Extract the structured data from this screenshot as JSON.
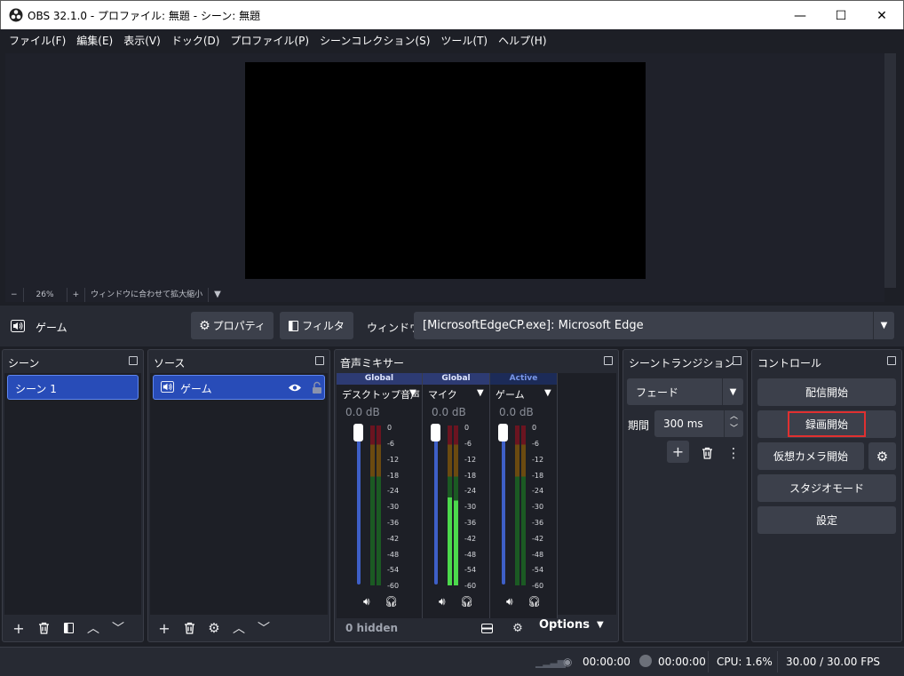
{
  "window": {
    "title": "OBS 32.1.0 - プロファイル: 無題 - シーン: 無題",
    "minimize": "—",
    "maximize": "☐",
    "close": "✕"
  },
  "menu": [
    "ファイル(F)",
    "編集(E)",
    "表示(V)",
    "ドック(D)",
    "プロファイル(P)",
    "シーンコレクション(S)",
    "ツール(T)",
    "ヘルプ(H)"
  ],
  "zoom": {
    "minus": "−",
    "value": "26%",
    "plus": "+",
    "fit": "ウィンドウに合わせて拡大縮小"
  },
  "context": {
    "source_name": "ゲーム",
    "properties": "プロパティ",
    "filters": "フィルタ",
    "window_label": "ウィンドウ",
    "window_value": "[MicrosoftEdgeCP.exe]: Microsoft Edge"
  },
  "scenes": {
    "title": "シーン",
    "items": [
      "シーン 1"
    ]
  },
  "sources": {
    "title": "ソース",
    "items": [
      "ゲーム"
    ]
  },
  "mixer": {
    "title": "音声ミキサー",
    "channels": [
      {
        "badge": "Global",
        "name": "デスクトップ音声",
        "db": "0.0 dB",
        "level": 1.0
      },
      {
        "badge": "Global",
        "name": "マイク",
        "db": "0.0 dB",
        "level": 1.0
      },
      {
        "badge": "Active",
        "name": "ゲーム",
        "db": "0.0 dB",
        "level": 1.0
      }
    ],
    "ticks": [
      "0",
      "-6",
      "-12",
      "-18",
      "-24",
      "-30",
      "-36",
      "-42",
      "-48",
      "-54",
      "-60"
    ],
    "hidden": "0 hidden",
    "options": "Options"
  },
  "transitions": {
    "title": "シーントランジション",
    "type": "フェード",
    "duration_label": "期間",
    "duration": "300 ms"
  },
  "controls": {
    "title": "コントロール",
    "start_streaming": "配信開始",
    "start_recording": "録画開始",
    "virtual_camera": "仮想カメラ開始",
    "studio_mode": "スタジオモード",
    "settings": "設定"
  },
  "status": {
    "stream_time": "00:00:00",
    "rec_time": "00:00:00",
    "cpu": "CPU: 1.6%",
    "fps": "30.00 / 30.00 FPS"
  },
  "colors": {
    "accent": "#284cb8",
    "bg": "#1d1f26",
    "panel": "#272a33",
    "button": "#3c404b",
    "highlight_border": "#e03030"
  }
}
